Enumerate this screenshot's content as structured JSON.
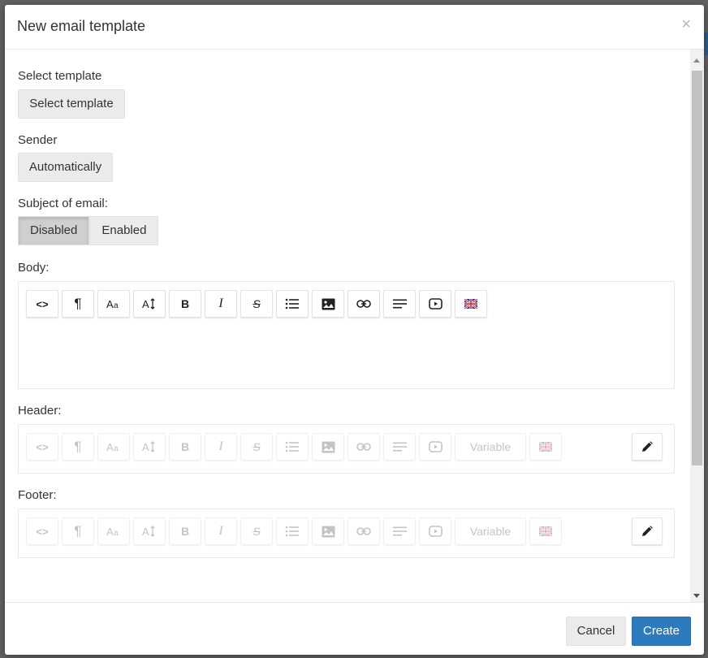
{
  "dialog": {
    "title": "New email template",
    "close_glyph": "×"
  },
  "fields": {
    "select_template": {
      "label": "Select template",
      "button": "Select template"
    },
    "sender": {
      "label": "Sender",
      "button": "Automatically"
    },
    "subject": {
      "label": "Subject of email:",
      "options": [
        "Disabled",
        "Enabled"
      ],
      "selected": "Disabled"
    },
    "body": {
      "label": "Body:"
    },
    "header": {
      "label": "Header:",
      "variable": "Variable"
    },
    "footer": {
      "label": "Footer:",
      "variable": "Variable"
    }
  },
  "toolbar_icons": [
    "code-view-icon",
    "paragraph-icon",
    "font-size-icon",
    "line-height-icon",
    "bold-icon",
    "italic-icon",
    "strikethrough-icon",
    "list-icon",
    "image-icon",
    "link-icon",
    "align-icon",
    "video-icon",
    "language-flag-icon"
  ],
  "toolbar_glyphs": {
    "code": "<>",
    "paragraph": "¶",
    "bold": "B",
    "italic": "I",
    "strike": "S"
  },
  "footer": {
    "cancel": "Cancel",
    "create": "Create"
  },
  "colors": {
    "primary": "#2d7bbd",
    "backdrop": "#5f6163"
  }
}
